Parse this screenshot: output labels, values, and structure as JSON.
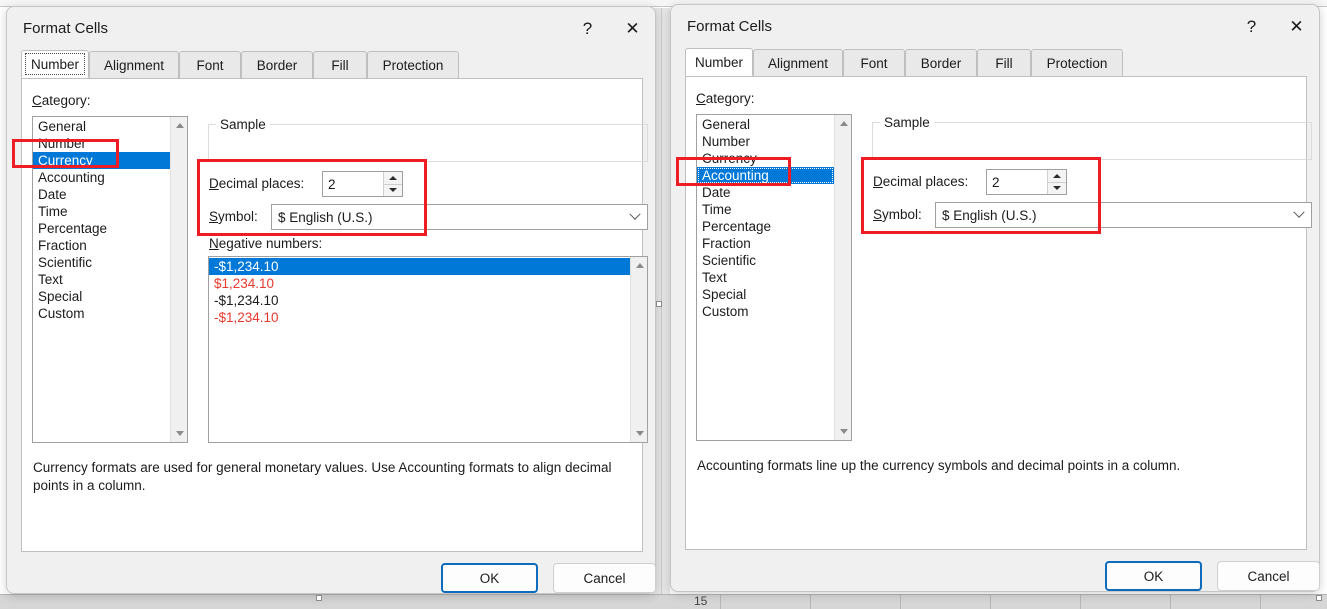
{
  "window_title": "Format Cells",
  "titlebar": {
    "help_icon": "question-mark-icon",
    "help_glyph": "?",
    "close_icon": "close-icon",
    "close_glyph": "✕"
  },
  "tabs": [
    {
      "label": "Number"
    },
    {
      "label": "Alignment"
    },
    {
      "label": "Font"
    },
    {
      "label": "Border"
    },
    {
      "label": "Fill"
    },
    {
      "label": "Protection"
    }
  ],
  "labels": {
    "category": "Category:",
    "sample": "Sample",
    "decimal_places": "Decimal places:",
    "symbol": "Symbol:",
    "negative_numbers": "Negative numbers:"
  },
  "categories": [
    "General",
    "Number",
    "Currency",
    "Accounting",
    "Date",
    "Time",
    "Percentage",
    "Fraction",
    "Scientific",
    "Text",
    "Special",
    "Custom"
  ],
  "left_dialog": {
    "title": "Format Cells",
    "active_tab": "Number",
    "tab_focused": true,
    "selected_category": "Currency",
    "sample_value": "",
    "decimal_places": "2",
    "symbol": "$ English (U.S.)",
    "negative_numbers": [
      {
        "text": "-$1,234.10",
        "color": "black",
        "selected": true
      },
      {
        "text": "$1,234.10",
        "color": "red",
        "selected": false
      },
      {
        "text": "-$1,234.10",
        "color": "black",
        "selected": false
      },
      {
        "text": "-$1,234.10",
        "color": "red",
        "selected": false
      }
    ],
    "description": "Currency formats are used for general monetary values.  Use Accounting formats to align decimal points in a column.",
    "ok_label": "OK",
    "cancel_label": "Cancel"
  },
  "right_dialog": {
    "title": "Format Cells",
    "active_tab": "Number",
    "tab_focused": false,
    "selected_category": "Accounting",
    "sample_value": "",
    "decimal_places": "2",
    "symbol": "$ English (U.S.)",
    "description": "Accounting formats line up the currency symbols and decimal points in a column.",
    "ok_label": "OK",
    "cancel_label": "Cancel"
  },
  "background": {
    "row_header_label": "15"
  },
  "colors": {
    "accent_selection": "#0078d7",
    "annotation_red": "#ee1c25",
    "negative_red": "#e8392e",
    "default_button_border": "#0f6cbd",
    "dialog_face": "#f0f0f0"
  },
  "annotations": [
    {
      "name": "currency-category-highlight"
    },
    {
      "name": "currency-options-highlight"
    },
    {
      "name": "accounting-category-highlight"
    },
    {
      "name": "accounting-options-highlight"
    }
  ]
}
